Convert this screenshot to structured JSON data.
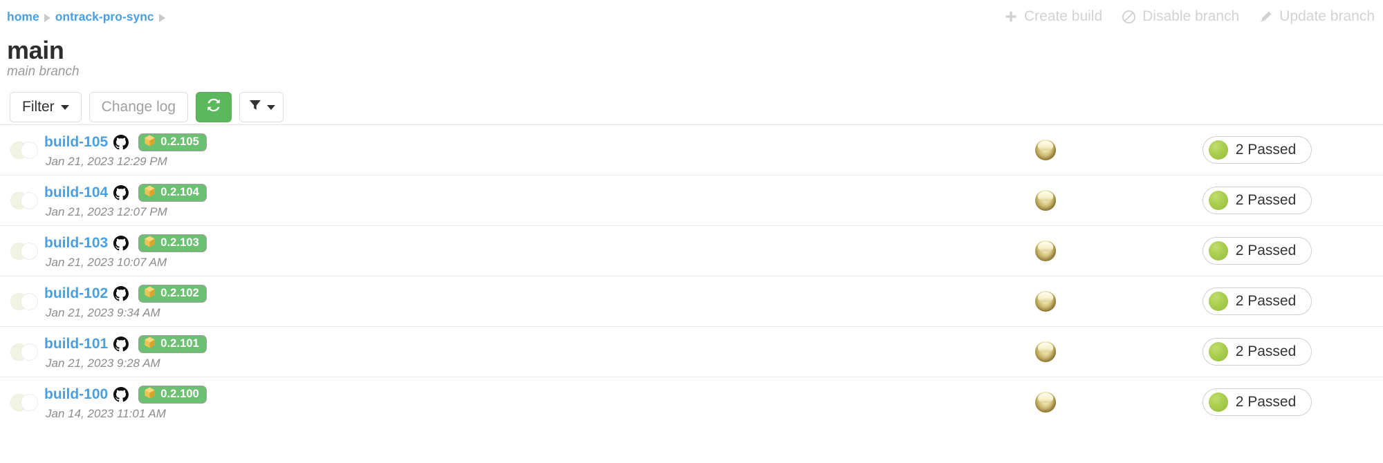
{
  "breadcrumb": {
    "items": [
      {
        "label": "home"
      },
      {
        "label": "ontrack-pro-sync"
      }
    ]
  },
  "header": {
    "title": "main",
    "subtitle": "main branch",
    "actions": [
      {
        "label": "Create build",
        "icon": "plus-icon"
      },
      {
        "label": "Disable branch",
        "icon": "ban-icon"
      },
      {
        "label": "Update branch",
        "icon": "pencil-icon"
      }
    ]
  },
  "toolbar": {
    "filter_label": "Filter",
    "change_log_label": "Change log",
    "refresh_icon": "refresh-icon",
    "funnel_icon": "funnel-icon"
  },
  "colors": {
    "link": "#4a9fe0",
    "badge_green": "#6cc071",
    "button_green": "#5cb85c",
    "passed_dot": "#a9ce4e",
    "muted_text": "#a0a0a0"
  },
  "builds": [
    {
      "name": "build-105",
      "timestamp": "Jan 21, 2023 12:29 PM",
      "scm_icon": "github-icon",
      "version": "0.2.105",
      "version_icon": "package-icon",
      "promotion_icon": "gold-promotion-icon",
      "validation": "2 Passed"
    },
    {
      "name": "build-104",
      "timestamp": "Jan 21, 2023 12:07 PM",
      "scm_icon": "github-icon",
      "version": "0.2.104",
      "version_icon": "package-icon",
      "promotion_icon": "gold-promotion-icon",
      "validation": "2 Passed"
    },
    {
      "name": "build-103",
      "timestamp": "Jan 21, 2023 10:07 AM",
      "scm_icon": "github-icon",
      "version": "0.2.103",
      "version_icon": "package-icon",
      "promotion_icon": "gold-promotion-icon",
      "validation": "2 Passed"
    },
    {
      "name": "build-102",
      "timestamp": "Jan 21, 2023 9:34 AM",
      "scm_icon": "github-icon",
      "version": "0.2.102",
      "version_icon": "package-icon",
      "promotion_icon": "gold-promotion-icon",
      "validation": "2 Passed"
    },
    {
      "name": "build-101",
      "timestamp": "Jan 21, 2023 9:28 AM",
      "scm_icon": "github-icon",
      "version": "0.2.101",
      "version_icon": "package-icon",
      "promotion_icon": "gold-promotion-icon",
      "validation": "2 Passed"
    },
    {
      "name": "build-100",
      "timestamp": "Jan 14, 2023 11:01 AM",
      "scm_icon": "github-icon",
      "version": "0.2.100",
      "version_icon": "package-icon",
      "promotion_icon": "gold-promotion-icon",
      "validation": "2 Passed"
    }
  ]
}
